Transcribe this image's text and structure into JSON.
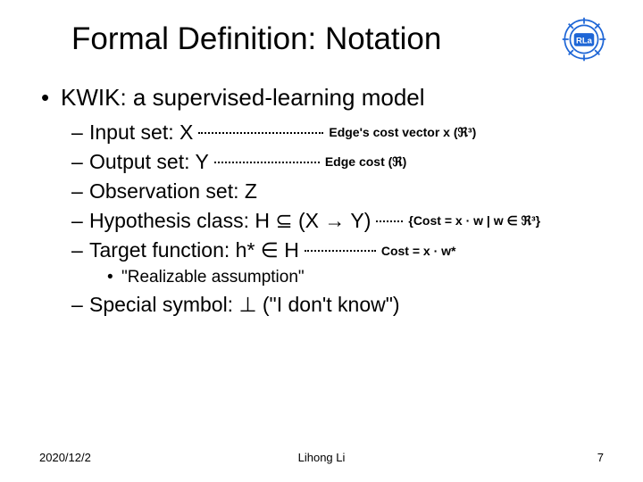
{
  "title": "Formal Definition: Notation",
  "top": "KWIK: a supervised-learning model",
  "items": {
    "input": {
      "text": "Input set: X",
      "annot": "Edge's cost vector x (ℜ³)"
    },
    "output": {
      "text": "Output set: Y",
      "annot": "Edge cost (ℜ)"
    },
    "obs": {
      "text": "Observation set: Z"
    },
    "hyp": {
      "text": "Hypothesis class: H ⊆ (X → Y)",
      "annot": "{Cost = x · w | w ∈ ℜ³}"
    },
    "target": {
      "text": "Target function: h* ∈ H",
      "annot": "Cost = x · w*"
    },
    "realize": {
      "text": "\"Realizable assumption\""
    },
    "special": {
      "text": "Special symbol: ⊥ (\"I don't know\")"
    }
  },
  "footer": {
    "date": "2020/12/2",
    "author": "Lihong Li",
    "page": "7"
  }
}
